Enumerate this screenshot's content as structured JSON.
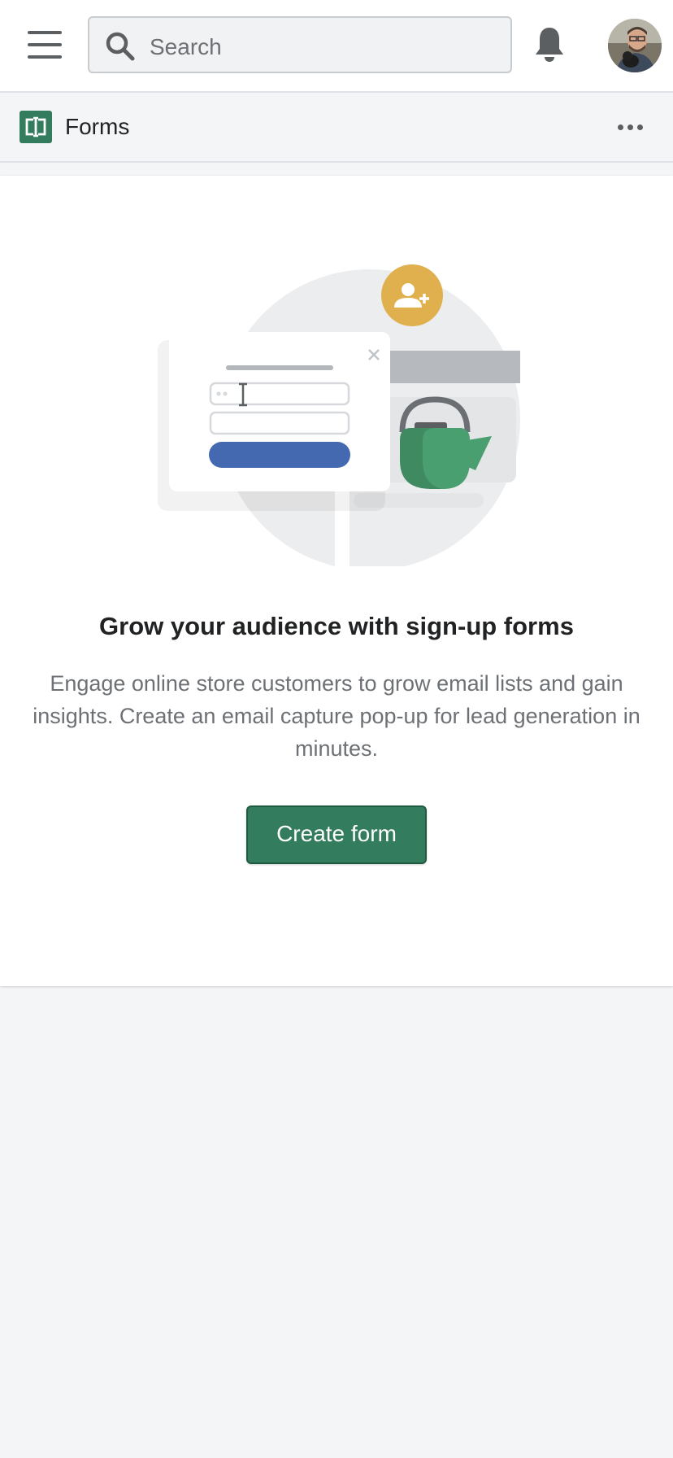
{
  "topbar": {
    "menu_icon": "hamburger-icon",
    "search": {
      "placeholder": "Search",
      "icon": "search-icon"
    },
    "notifications_icon": "bell-icon",
    "avatar": "user-avatar"
  },
  "app": {
    "title": "Forms",
    "icon": "forms-app-icon",
    "more_icon": "more-horizontal-icon"
  },
  "empty_state": {
    "heading": "Grow your audience with sign-up forms",
    "description": "Engage online store customers to grow email lists and gain insights. Create an email capture pop-up for lead generation in minutes.",
    "primary_action": "Create form"
  },
  "colors": {
    "brand_green": "#347c5e",
    "button_blue": "#4469b0",
    "badge_gold": "#e0b04e",
    "teapot_green": "#449b6e"
  }
}
